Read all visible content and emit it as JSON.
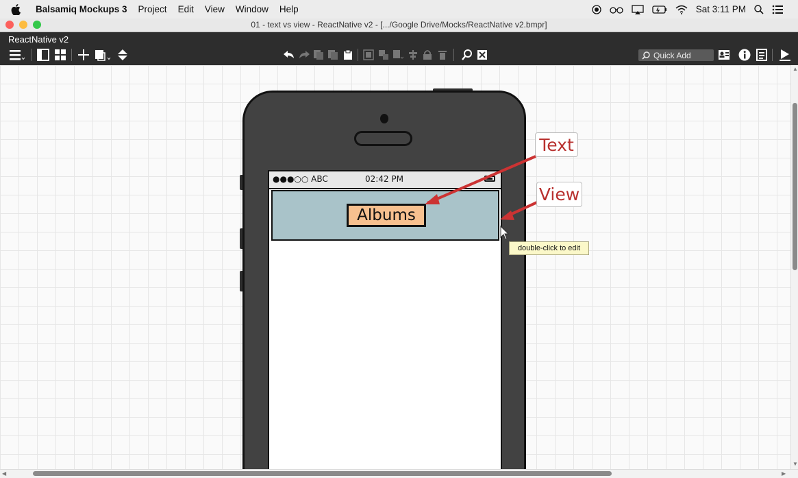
{
  "menubar": {
    "app_name": "Balsamiq Mockups 3",
    "items": [
      "Project",
      "Edit",
      "View",
      "Window",
      "Help"
    ],
    "clock": "Sat 3:11 PM"
  },
  "window": {
    "title": "01 - text vs view - ReactNative v2 - [.../Google Drive/Mocks/ReactNative v2.bmpr]"
  },
  "app": {
    "project_name": "ReactNative v2",
    "quick_add_placeholder": "Quick Add"
  },
  "mockup": {
    "status_carrier": "●●●○○ ABC",
    "status_time": "02:42 PM",
    "albums_label": "Albums",
    "callout_text": "Text",
    "callout_view": "View",
    "tooltip": "double-click to edit"
  },
  "colors": {
    "canvas_bg": "#fafafa",
    "phone_body": "#424242",
    "nav_view_fill": "#a9c3c9",
    "albums_fill": "#f7c08f",
    "callout_red": "#b8302e",
    "tooltip_bg": "#fbf8c9"
  },
  "icons": [
    "apple-icon",
    "hamburger-menu-icon",
    "panel-icon",
    "grid-icon",
    "add-icon",
    "duplicate-icon",
    "move-up-down-icon",
    "undo-icon",
    "redo-icon",
    "copy-icon",
    "paste-icon",
    "clipboard-icon",
    "group-icon",
    "ungroup-icon",
    "lock-icon",
    "delete-icon",
    "search-icon",
    "close-icon",
    "info-icon",
    "list-icon",
    "present-icon",
    "wifi-icon",
    "battery-icon"
  ]
}
